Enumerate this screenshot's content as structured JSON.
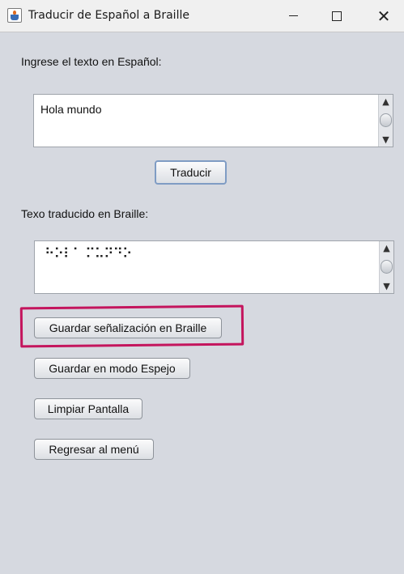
{
  "window": {
    "title": "Traducir de Español a Braille",
    "controls": {
      "minimize": "minimize-icon",
      "maximize": "maximize-icon",
      "close": "close-icon"
    }
  },
  "input_section": {
    "label": "Ingrese el texto en Español:",
    "value": "Hola mundo"
  },
  "translate_button": "Traducir",
  "output_section": {
    "label": "Texo traducido en Braille:",
    "value": "⠓⠕⠇⠁ ⠍⠥⠝⠙⠕"
  },
  "actions": {
    "save_braille": "Guardar señalización en Braille",
    "save_mirror": "Guardar en modo Espejo",
    "clear": "Limpiar Pantalla",
    "back": "Regresar al menú"
  },
  "colors": {
    "highlight": "#c4155d",
    "window_bg": "#d6d9e0"
  }
}
